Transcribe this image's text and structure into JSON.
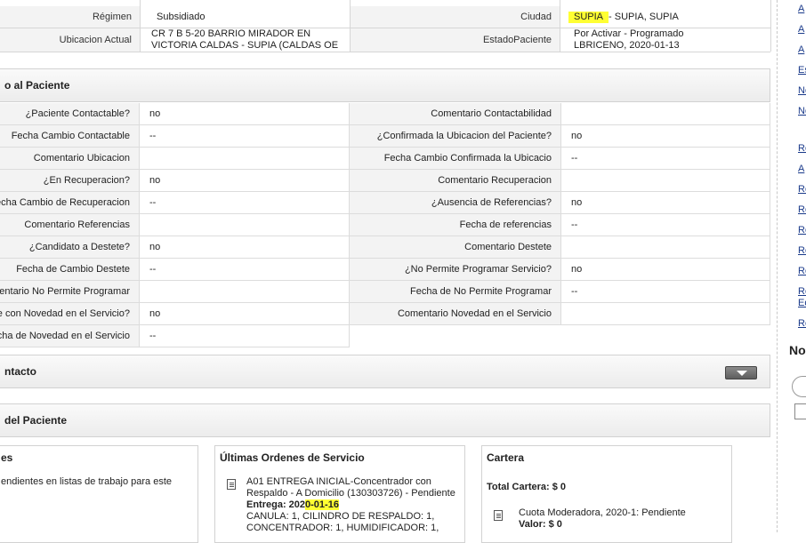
{
  "header": {
    "regimen_label": "Régimen",
    "regimen_value": "Subsidiado",
    "ciudad_label": "Ciudad",
    "ciudad_value_highlight": "SUPIA",
    "ciudad_value_rest": " - SUPIA, SUPIA",
    "ubicacion_label": "Ubicacion Actual",
    "ubicacion_line1": "CR 7 B 5-20 BARRIO MIRADOR EN",
    "ubicacion_line2": "VICTORIA CALDAS - SUPIA (CALDAS OE",
    "estado_label": "EstadoPaciente",
    "estado_line1": "Por Activar - Programado",
    "estado_line2": "LBRICENO, 2020-01-13"
  },
  "section_paciente": {
    "title": "o al Paciente",
    "left_rows": [
      {
        "label": "¿Paciente Contactable?",
        "value": "no"
      },
      {
        "label": "Fecha Cambio Contactable",
        "value": "--"
      },
      {
        "label": "Comentario Ubicacion",
        "value": ""
      },
      {
        "label": "¿En Recuperacion?",
        "value": "no"
      },
      {
        "label": "echa Cambio de Recuperacion",
        "value": "--"
      },
      {
        "label": "Comentario Referencias",
        "value": ""
      },
      {
        "label": "¿Candidato a Destete?",
        "value": "no"
      },
      {
        "label": "Fecha de Cambio Destete",
        "value": "--"
      },
      {
        "label": "mentario No Permite Programar",
        "value": ""
      },
      {
        "label": "e con Novedad en el Servicio?",
        "value": "no"
      },
      {
        "label": "cha de Novedad en el Servicio",
        "value": "--"
      }
    ],
    "right_rows": [
      {
        "label": "Comentario Contactabilidad",
        "value": ""
      },
      {
        "label": "¿Confirmada la Ubicacion del Paciente?",
        "value": "no"
      },
      {
        "label": "Fecha Cambio Confirmada la Ubicacio",
        "value": "--"
      },
      {
        "label": "Comentario Recuperacion",
        "value": ""
      },
      {
        "label": "¿Ausencia de Referencias?",
        "value": "no"
      },
      {
        "label": "Fecha de referencias",
        "value": "--"
      },
      {
        "label": "Comentario Destete",
        "value": ""
      },
      {
        "label": "¿No Permite Programar Servicio?",
        "value": "no"
      },
      {
        "label": "Fecha de No Permite Programar",
        "value": "--"
      },
      {
        "label": "Comentario Novedad en el Servicio",
        "value": ""
      }
    ]
  },
  "section_contacto": {
    "title": "ntacto"
  },
  "section_del_paciente": {
    "title": "del Paciente"
  },
  "panel_pendientes": {
    "title": "es",
    "text": "endientes en listas de trabajo para este"
  },
  "panel_ordenes": {
    "title": "Últimas Ordenes de Servicio",
    "item_line1": "A01 ENTREGA INICIAL-Concentrador con",
    "item_line2": "Respaldo - A Domicilio (130303726) - Pendiente",
    "entrega_label": "Entrega: 202",
    "entrega_highlight": "0-01-16",
    "detail_line1": "CANULA: 1, CILINDRO DE RESPALDO: 1,",
    "detail_line2": "CONCENTRADOR: 1, HUMIDIFICADOR: 1,"
  },
  "panel_cartera": {
    "title": "Cartera",
    "total": "Total Cartera: $ 0",
    "item_line1": "Cuota Moderadora, 2020-1: Pendiente",
    "item_value": "Valor: $ 0"
  },
  "right_links": [
    "A",
    "A",
    "A",
    "Es",
    "No",
    "No",
    "Re",
    "A",
    "Re",
    "Re",
    "Re",
    "Re",
    "Re",
    "Re",
    "Ed",
    "Re"
  ],
  "right_heading": "No",
  "colors": {
    "highlight": "#ffff33",
    "link": "#1a3a8a",
    "label_bg": "#f3f3f3"
  }
}
